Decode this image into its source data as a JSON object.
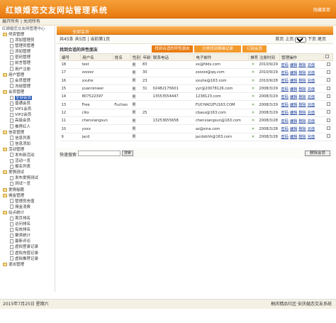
{
  "header": {
    "title": "红娘婚恋交友网站管理系统",
    "right_link": "隐藏菜单"
  },
  "subnav": {
    "expand_all": "展开所有",
    "collapse_all": "关闭所有"
  },
  "sidebar": {
    "root": "红娘婚恋交友网管理中心",
    "items": [
      {
        "label": "师资管理",
        "type": "folder",
        "level": 1
      },
      {
        "label": "添加管理员",
        "type": "leaf",
        "level": 2
      },
      {
        "label": "管理员管理",
        "type": "leaf",
        "level": 2
      },
      {
        "label": "添加管理",
        "type": "leaf",
        "level": 2
      },
      {
        "label": "密码管理",
        "type": "leaf",
        "level": 2
      },
      {
        "label": "前言管理",
        "type": "leaf",
        "level": 2
      },
      {
        "label": "用户注册",
        "type": "leaf",
        "level": 2
      },
      {
        "label": "用户管理",
        "type": "folder",
        "level": 1
      },
      {
        "label": "会员管理",
        "type": "leaf",
        "level": 2
      },
      {
        "label": "冻结管理",
        "type": "leaf",
        "level": 2
      },
      {
        "label": "会员管理",
        "type": "folder",
        "level": 1
      },
      {
        "label": "全部会员",
        "type": "leaf",
        "level": 2,
        "selected": true
      },
      {
        "label": "普通会员",
        "type": "leaf",
        "level": 2
      },
      {
        "label": "VIP1会员",
        "type": "leaf",
        "level": 2
      },
      {
        "label": "VIP2会员",
        "type": "leaf",
        "level": 2
      },
      {
        "label": "高级会员",
        "type": "leaf",
        "level": 2
      },
      {
        "label": "推荐红人",
        "type": "leaf",
        "level": 2
      },
      {
        "label": "信息管理",
        "type": "folder",
        "level": 1
      },
      {
        "label": "信息列表",
        "type": "leaf",
        "level": 2
      },
      {
        "label": "信息添加",
        "type": "leaf",
        "level": 2
      },
      {
        "label": "活动管理",
        "type": "folder",
        "level": 1
      },
      {
        "label": "发布新活动",
        "type": "leaf",
        "level": 2
      },
      {
        "label": "活动一览",
        "type": "leaf",
        "level": 2
      },
      {
        "label": "报名列表",
        "type": "leaf",
        "level": 2
      },
      {
        "label": "爱情测试",
        "type": "folder",
        "level": 1
      },
      {
        "label": "发布爱情测试",
        "type": "leaf",
        "level": 2
      },
      {
        "label": "测试一览",
        "type": "leaf",
        "level": 2
      },
      {
        "label": "爱情秘籍",
        "type": "folder",
        "level": 1
      },
      {
        "label": "佣金管理",
        "type": "folder",
        "level": 1
      },
      {
        "label": "管理员充值",
        "type": "leaf",
        "level": 2
      },
      {
        "label": "佣金消费",
        "type": "leaf",
        "level": 2
      },
      {
        "label": "站点统计",
        "type": "folder",
        "level": 1
      },
      {
        "label": "首页排名",
        "type": "leaf",
        "level": 2
      },
      {
        "label": "访问排名",
        "type": "leaf",
        "level": 2
      },
      {
        "label": "有效排名",
        "type": "leaf",
        "level": 2
      },
      {
        "label": "聚类统计",
        "type": "leaf",
        "level": 2
      },
      {
        "label": "最新评论",
        "type": "leaf",
        "level": 2
      },
      {
        "label": "虚拟登录记录",
        "type": "leaf",
        "level": 2
      },
      {
        "label": "虚拟充值记录",
        "type": "leaf",
        "level": 2
      },
      {
        "label": "虚拟推荐记录",
        "type": "leaf",
        "level": 2
      },
      {
        "label": "退出管理",
        "type": "folder",
        "level": 1
      }
    ]
  },
  "content": {
    "tab_title": "全部会员",
    "pager": {
      "total": "共45条",
      "pages": "共5页",
      "current": "当前第1页",
      "first": "首页",
      "prev": "上页",
      "page_value": "1",
      "next": "下页",
      "last": "尾页"
    },
    "filter": {
      "label": "找到合适的异性朋友",
      "tabs": [
        "找到合适的异性朋友",
        "分类找到择缘记录",
        "订阅会员"
      ]
    },
    "columns": [
      "编号",
      "用户名",
      "姓名",
      "性别",
      "年龄",
      "联系电话",
      "电子邮件",
      "推荐",
      "注册时间",
      "管理操作",
      ""
    ],
    "rows": [
      {
        "id": "18",
        "username": "test",
        "name": "",
        "gender": "男",
        "age": "83",
        "phone": "",
        "email": "xx@fdds.com",
        "date": "2010/9/29"
      },
      {
        "id": "17",
        "username": "zzzzzz",
        "name": "",
        "gender": "男",
        "age": "30",
        "phone": "",
        "email": "zzzzzz@qq.com",
        "date": "2010/9/29"
      },
      {
        "id": "16",
        "username": "xxuhe",
        "name": "",
        "gender": "男",
        "age": "23",
        "phone": "",
        "email": "xxuhe@163.com",
        "date": "2010/9/28"
      },
      {
        "id": "15",
        "username": "yuanrenwei",
        "name": "",
        "gender": "男",
        "age": "31",
        "phone": "02482175601",
        "email": "yyr@20078126.com",
        "date": "2008/3/29"
      },
      {
        "id": "14",
        "username": "807522397",
        "name": "",
        "gender": "男",
        "age": "",
        "phone": "13553554447",
        "email": "1238123.com",
        "date": "2008/3/29"
      },
      {
        "id": "13",
        "username": "Free",
        "name": "Fuchao",
        "gender": "男",
        "age": "",
        "phone": "",
        "email": "FUCHAO2FU163.COM",
        "date": "2008/3/29"
      },
      {
        "id": "12",
        "username": "clks",
        "name": "",
        "gender": "男",
        "age": "25",
        "phone": "",
        "email": "cbaus@163.com",
        "date": "2008/3/29"
      },
      {
        "id": "11",
        "username": "chenxiangsun",
        "name": "",
        "gender": "男",
        "age": "",
        "phone": "13253655658",
        "email": "chenxiangsun@163.com",
        "date": "2008/3/28"
      },
      {
        "id": "10",
        "username": "yxxx",
        "name": "",
        "gender": "男",
        "age": "",
        "phone": "",
        "email": "az@sina.com",
        "date": "2008/3/28"
      },
      {
        "id": "9",
        "username": "jacd",
        "name": "",
        "gender": "男",
        "age": "",
        "phone": "",
        "email": "jacdsbhh@163.com",
        "date": "2008/3/28"
      }
    ],
    "row_actions": [
      "密码",
      "编辑",
      "删除",
      "充值"
    ],
    "recommend_mark": "✕",
    "quick_search_label": "快速搜索",
    "search_button": "搜索",
    "delete_button": "删除会员"
  },
  "status": {
    "date": "2015年7月25日 星期六",
    "copyright": "桐庆精品社区·安庆婚恋交友系统"
  }
}
